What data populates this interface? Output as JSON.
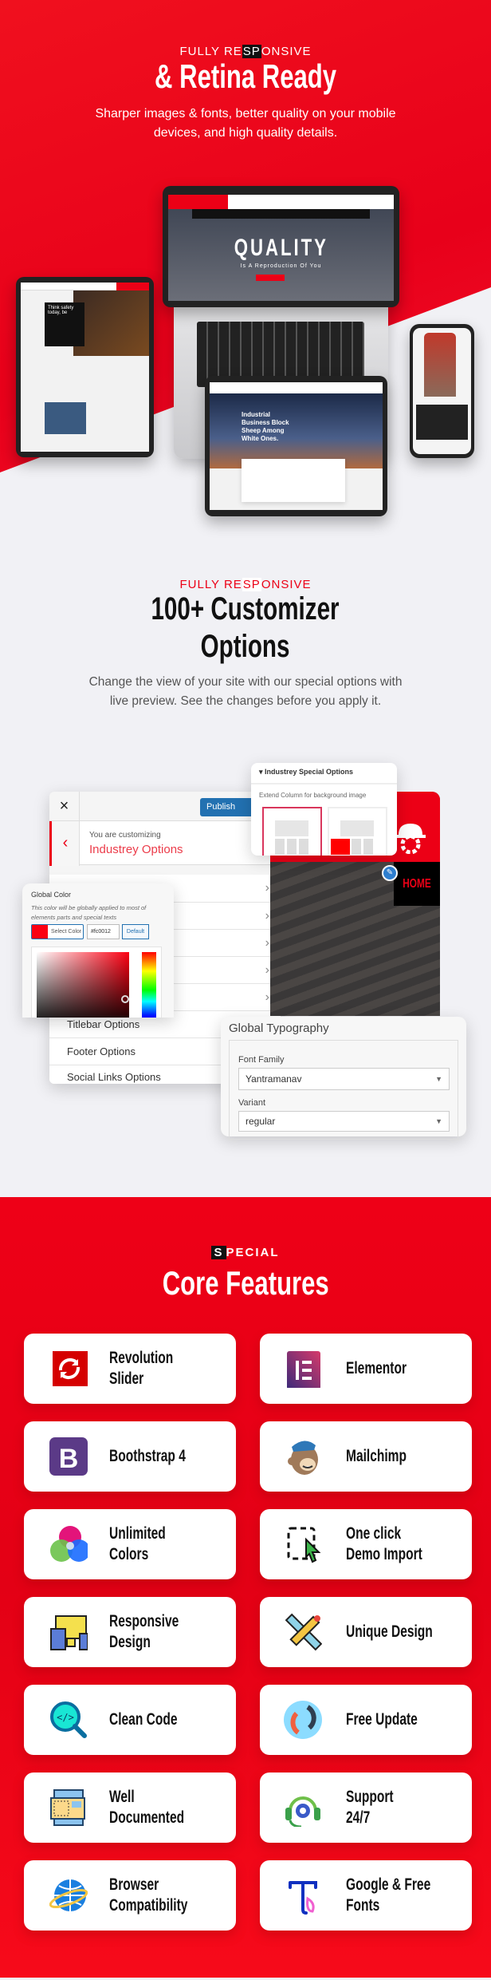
{
  "hero": {
    "kicker_pre": "FULLY RE",
    "kicker_hl": "SP",
    "kicker_post": "ONSIVE",
    "title": "& Retina Ready",
    "subtitle_line1": "Sharper images & fonts, better quality on your mobile",
    "subtitle_line2": "devices, and high quality details.",
    "laptop_headline": "QUALITY",
    "laptop_tagline": "Is A Reproduction Of You",
    "tablet_left_headline": "Think safety today, be",
    "tablet_center_headline": "Industrial Business Block Sheep Among White Ones."
  },
  "customizer": {
    "kicker_pre": "FULLY RE",
    "kicker_hl": "SP",
    "kicker_post": "ONSIVE",
    "title_line1": "100+ Customizer",
    "title_line2": "Options",
    "desc_line1": "Change the view of your site with our special options with",
    "desc_line2": "live preview. See the changes before you apply it.",
    "panel": {
      "close": "×",
      "publish": "Publish",
      "back": "‹",
      "customizing_label": "You are customizing",
      "section_title": "Industrey Options",
      "rows": [
        "Titlebar Options",
        "Footer Options",
        "Social Links Options"
      ]
    },
    "special": {
      "title": "Industrey Special Options",
      "label": "Extend Column for background image"
    },
    "preview": {
      "menu": "HOME"
    },
    "global_color": {
      "title": "Global Color",
      "desc_line1": "This color will be globally applied to most of",
      "desc_line2": "elements parts and special texts",
      "select_label": "Select Color",
      "hex_value": "#fc0012",
      "default_label": "Default",
      "color": "#fc0012"
    },
    "typography": {
      "title": "Global Typography",
      "font_family_label": "Font Family",
      "font_family_value": "Yantramanav",
      "variant_label": "Variant",
      "variant_value": "regular"
    }
  },
  "features": {
    "kicker_hl": "S",
    "kicker_post": "PECIAL",
    "title": "Core Features",
    "items": [
      {
        "label1": "Revolution",
        "label2": "Slider",
        "icon": "refresh-icon"
      },
      {
        "label1": "Elementor",
        "label2": "",
        "icon": "elementor-icon"
      },
      {
        "label1": "Boothstrap 4",
        "label2": "",
        "icon": "bootstrap-icon"
      },
      {
        "label1": "Mailchimp",
        "label2": "",
        "icon": "mailchimp-icon"
      },
      {
        "label1": "Unlimited",
        "label2": "Colors",
        "icon": "color-circles-icon"
      },
      {
        "label1": "One click",
        "label2": "Demo Import",
        "icon": "cursor-select-icon"
      },
      {
        "label1": "Responsive",
        "label2": "Design",
        "icon": "devices-icon"
      },
      {
        "label1": "Unique Design",
        "label2": "",
        "icon": "pencil-ruler-icon"
      },
      {
        "label1": "Clean Code",
        "label2": "",
        "icon": "code-search-icon"
      },
      {
        "label1": "Free Update",
        "label2": "",
        "icon": "update-icon"
      },
      {
        "label1": "Well",
        "label2": "Documented",
        "icon": "document-icon"
      },
      {
        "label1": "Support",
        "label2": "24/7",
        "icon": "headset-icon"
      },
      {
        "label1": "Browser",
        "label2": "Compatibility",
        "icon": "globe-icon"
      },
      {
        "label1": "Google & Free",
        "label2": "Fonts",
        "icon": "typography-icon"
      }
    ]
  },
  "colors": {
    "brand_red": "#ec0016",
    "dark": "#111111",
    "publish_blue": "#2271b1"
  }
}
